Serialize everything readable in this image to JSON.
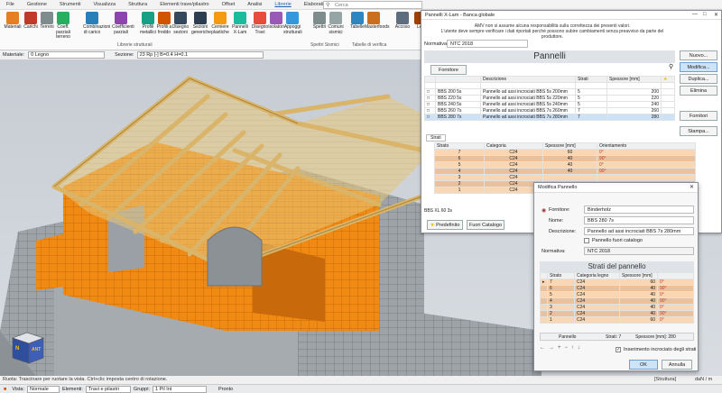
{
  "menu": [
    "File",
    "Gestione",
    "Strumenti",
    "Visualizza",
    "Struttura",
    "Elementi trave/pilastro",
    "Offset",
    "Analisi",
    "Librerie",
    "Elaborati",
    "BIM"
  ],
  "menu_active": "Librerie",
  "search": {
    "placeholder": "Cerca"
  },
  "ribbon": {
    "buttons": [
      "Materiali",
      "Carichi",
      "Terreni",
      "Coeff. parziali terreno",
      "Combinazioni di carico",
      "Coefficienti parziali",
      "Profili metallici",
      "Profili a freddo",
      "Disegno sezioni",
      "Sezioni generiche",
      "Cerniere plastiche",
      "Pannelli X-Lam",
      "Disegno Travi",
      "Isolatori",
      "Appoggi strutturali",
      "Spettri",
      "Comuni sismici",
      "Tabelle",
      "Masterfoods",
      "Accoso",
      "Leg"
    ],
    "groups": [
      "Librerie strutturali",
      "Spettri Sismici",
      "Tabelle di verifica"
    ]
  },
  "propbar": {
    "materiale_label": "Materiale:",
    "materiale_value": "0 Legno",
    "sezione_label": "Sezione:",
    "sezione_value": "23 Rp [-] B=0.4 H=0.1"
  },
  "viewcube": {
    "face_left": "N",
    "face_right": "ANT"
  },
  "status": {
    "text": "Ruota: Trascinare per ruotare la vista. Ctrl+clic imposta centro di rotazione.",
    "units": "daN / m",
    "mode": "[Struttura]"
  },
  "bottombar": {
    "vista_label": "Vista:",
    "vista_value": "Normale",
    "elementi_label": "Elementi:",
    "elementi_value": "Travi e pilastri",
    "gruppi_label": "Gruppi:",
    "gruppi_value": "1 Pil Int",
    "pronto": "Pronto"
  },
  "dlg1": {
    "title": "Pannelli X-Lam - Banca globale",
    "note1": "AMV non si assume alcuna responsabilità sulla correttezza dei presenti valori.",
    "note2": "L'utente deve sempre verificare i dati riportati perché possono subire cambiamenti senza preavviso da parte del produttore.",
    "normativa_label": "Normativa:",
    "normativa_value": "NTC 2018",
    "section_title": "Pannelli",
    "fornitore_btn": "Fornitore",
    "cols": [
      "Descrizione",
      "Strati",
      "Spessore [mm]"
    ],
    "rows": [
      {
        "name": "BBS 200 5s",
        "desc": "Pannello ad assi incrociati BBS 5s 200mm",
        "strati": "5",
        "sp": "200"
      },
      {
        "name": "BBS 220 5s",
        "desc": "Pannello ad assi incrociati BBS 5s 220mm",
        "strati": "5",
        "sp": "220"
      },
      {
        "name": "BBS 240 5s",
        "desc": "Pannello ad assi incrociati BBS 5s 240mm",
        "strati": "5",
        "sp": "240"
      },
      {
        "name": "BBS 260 7s",
        "desc": "Pannello ad assi incrociati BBS 7s 260mm",
        "strati": "7",
        "sp": "260"
      },
      {
        "name": "BBS 280 7s",
        "desc": "Pannello ad assi incrociati BBS 7s 280mm",
        "strati": "7",
        "sp": "280"
      }
    ],
    "strati_tab": "Strati",
    "strati_cols": [
      "Strato",
      "Categoria",
      "Spessore [mm]",
      "Orientamento"
    ],
    "strati_rows": [
      {
        "s": "7",
        "c": "C24",
        "sp": "60",
        "o": "0°"
      },
      {
        "s": "6",
        "c": "C24",
        "sp": "40",
        "o": "90°"
      },
      {
        "s": "5",
        "c": "C24",
        "sp": "40",
        "o": "0°"
      },
      {
        "s": "4",
        "c": "C24",
        "sp": "40",
        "o": "90°"
      },
      {
        "s": "3",
        "c": "C24",
        "sp": "",
        "o": ""
      },
      {
        "s": "2",
        "c": "C24",
        "sp": "",
        "o": ""
      },
      {
        "s": "1",
        "c": "C24",
        "sp": "",
        "o": ""
      }
    ],
    "extra_row": "BBS XL 60 3s",
    "predefinito": "Predefinito",
    "fuori": "Fuori Catalogo",
    "buttons": [
      "Nuovo...",
      "Modifica...",
      "Duplica...",
      "Elimina",
      "Fornitori",
      "Stampa..."
    ]
  },
  "dlg2": {
    "title": "Modifica Pannello",
    "fornitore_label": "Fornitore:",
    "fornitore_value": "Binderholz",
    "nome_label": "Nome:",
    "nome_value": "BBS 280 7s",
    "desc_label": "Descrizione:",
    "desc_value": "Pannello ad assi incrociati BBS 7s 280mm",
    "fuori_label": "Pannello fuori catalogo",
    "normativa_label": "Normativa:",
    "normativa_value": "NTC 2018",
    "section_title": "Strati del pannello",
    "cols": [
      "Strato",
      "Categoria legno",
      "Spessore [mm]"
    ],
    "rows": [
      {
        "s": "7",
        "c": "C24",
        "sp": "60",
        "o": "0°"
      },
      {
        "s": "6",
        "c": "C24",
        "sp": "40",
        "o": "90°"
      },
      {
        "s": "5",
        "c": "C24",
        "sp": "40",
        "o": "0°"
      },
      {
        "s": "4",
        "c": "C24",
        "sp": "40",
        "o": "90°"
      },
      {
        "s": "3",
        "c": "C24",
        "sp": "40",
        "o": "0°"
      },
      {
        "s": "2",
        "c": "C24",
        "sp": "40",
        "o": "90°"
      },
      {
        "s": "1",
        "c": "C24",
        "sp": "60",
        "o": "0°"
      }
    ],
    "footer_label": "Pannello",
    "footer_strati": "Strati: 7",
    "footer_sp": "Spessore [mm]: 280",
    "insert_label": "Inserimento incrociato degli strati",
    "ok": "OK",
    "cancel": "Annulla"
  }
}
